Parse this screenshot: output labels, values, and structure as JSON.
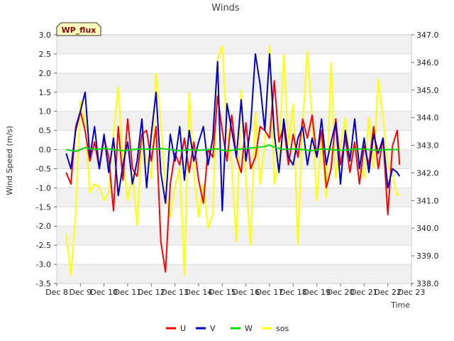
{
  "chart_data": {
    "type": "line",
    "title": "Winds",
    "xlabel": "Time",
    "ylabel": "Wind Speed (m/s)",
    "badge": "WP_flux",
    "x_range": [
      8,
      23
    ],
    "x_ticks": [
      "Dec 8",
      "Dec 9",
      "Dec 10",
      "Dec 11",
      "Dec 12",
      "Dec 13",
      "Dec 14",
      "Dec 15",
      "Dec 16",
      "Dec 17",
      "Dec 18",
      "Dec 19",
      "Dec 20",
      "Dec 21",
      "Dec 22",
      "Dec 23"
    ],
    "ylim": [
      -3.5,
      3.0
    ],
    "y_ticks": [
      "-3.5",
      "-3.0",
      "-2.5",
      "-2.0",
      "-1.5",
      "-1.0",
      "-0.5",
      "0.0",
      "0.5",
      "1.0",
      "1.5",
      "2.0",
      "2.5",
      "3.0"
    ],
    "y2lim": [
      338.0,
      347.0
    ],
    "y2_ticks": [
      "338.0",
      "339.0",
      "340.0",
      "341.0",
      "342.0",
      "343.0",
      "344.0",
      "345.0",
      "346.0",
      "347.0"
    ],
    "grid": "horizontal bands",
    "legend_position": "bottom",
    "series": [
      {
        "name": "U",
        "color": "#ff0000",
        "axis": "left",
        "x": [
          8.4,
          8.6,
          8.8,
          9.0,
          9.2,
          9.4,
          9.6,
          9.8,
          10.0,
          10.2,
          10.4,
          10.6,
          10.8,
          11.0,
          11.2,
          11.4,
          11.6,
          11.8,
          12.0,
          12.2,
          12.4,
          12.6,
          12.8,
          13.0,
          13.2,
          13.4,
          13.6,
          13.8,
          14.0,
          14.2,
          14.4,
          14.6,
          14.8,
          15.0,
          15.2,
          15.4,
          15.6,
          15.8,
          16.0,
          16.2,
          16.4,
          16.6,
          16.8,
          17.0,
          17.2,
          17.4,
          17.6,
          17.8,
          18.0,
          18.2,
          18.4,
          18.6,
          18.8,
          19.0,
          19.2,
          19.4,
          19.6,
          19.8,
          20.0,
          20.2,
          20.4,
          20.6,
          20.8,
          21.0,
          21.2,
          21.4,
          21.6,
          21.8,
          22.0,
          22.2,
          22.4,
          22.5
        ],
        "y": [
          -0.6,
          -0.9,
          0.6,
          1.0,
          0.5,
          -0.3,
          0.2,
          -0.5,
          0.3,
          -0.2,
          -1.6,
          0.6,
          -0.8,
          0.8,
          -0.5,
          -0.7,
          0.4,
          0.5,
          -0.3,
          0.6,
          -2.4,
          -3.2,
          -0.9,
          -0.1,
          -0.4,
          0.3,
          -0.6,
          0.2,
          -0.8,
          -1.4,
          0.0,
          -0.2,
          1.4,
          0.5,
          -0.3,
          0.9,
          -0.2,
          -0.6,
          0.7,
          -0.5,
          -0.2,
          0.6,
          0.5,
          0.3,
          1.8,
          0.2,
          0.6,
          -0.4,
          0.4,
          -0.2,
          0.8,
          0.3,
          0.9,
          -0.2,
          0.5,
          -1.0,
          -0.5,
          0.8,
          -0.4,
          0.3,
          -0.6,
          0.2,
          -0.9,
          0.1,
          -0.4,
          0.6,
          -0.5,
          0.3,
          -1.7,
          0.1,
          0.5,
          -0.4
        ]
      },
      {
        "name": "V",
        "color": "#0000cc",
        "axis": "left",
        "x": [
          8.4,
          8.6,
          8.8,
          9.0,
          9.2,
          9.4,
          9.6,
          9.8,
          10.0,
          10.2,
          10.4,
          10.6,
          10.8,
          11.0,
          11.2,
          11.4,
          11.6,
          11.8,
          12.0,
          12.2,
          12.4,
          12.6,
          12.8,
          13.0,
          13.2,
          13.4,
          13.6,
          13.8,
          14.0,
          14.2,
          14.4,
          14.6,
          14.8,
          15.0,
          15.2,
          15.4,
          15.6,
          15.8,
          16.0,
          16.2,
          16.4,
          16.6,
          16.8,
          17.0,
          17.2,
          17.4,
          17.6,
          17.8,
          18.0,
          18.2,
          18.4,
          18.6,
          18.8,
          19.0,
          19.2,
          19.4,
          19.6,
          19.8,
          20.0,
          20.2,
          20.4,
          20.6,
          20.8,
          21.0,
          21.2,
          21.4,
          21.6,
          21.8,
          22.0,
          22.2,
          22.4,
          22.5
        ],
        "y": [
          -0.1,
          -0.5,
          0.5,
          1.0,
          1.5,
          -0.2,
          0.6,
          -0.5,
          0.4,
          -0.6,
          0.3,
          -1.2,
          -0.4,
          0.2,
          -0.9,
          -0.3,
          0.8,
          -1.0,
          0.4,
          1.5,
          -0.6,
          -1.4,
          0.4,
          -0.3,
          0.6,
          -0.8,
          0.5,
          -0.3,
          0.2,
          0.6,
          -0.4,
          0.3,
          2.3,
          -1.6,
          1.2,
          0.5,
          -0.2,
          1.3,
          -0.3,
          0.6,
          2.5,
          1.7,
          0.5,
          2.5,
          0.4,
          -0.6,
          0.8,
          -0.2,
          -0.4,
          0.3,
          0.6,
          -0.4,
          0.3,
          -0.2,
          0.8,
          -0.4,
          0.2,
          0.7,
          -0.9,
          0.5,
          -0.3,
          0.8,
          -0.5,
          0.3,
          -0.6,
          0.4,
          -0.1,
          0.3,
          -1.0,
          -0.5,
          -0.6,
          -0.7
        ]
      },
      {
        "name": "W",
        "color": "#00dd00",
        "axis": "left",
        "x": [
          8.4,
          8.8,
          9.2,
          9.6,
          10.0,
          10.4,
          10.8,
          11.2,
          11.6,
          12.0,
          12.4,
          12.8,
          13.2,
          13.6,
          14.0,
          14.4,
          14.8,
          15.2,
          15.6,
          16.0,
          16.4,
          16.8,
          17.0,
          17.2,
          17.6,
          18.0,
          18.4,
          18.8,
          19.2,
          19.6,
          20.0,
          20.4,
          20.8,
          21.2,
          21.6,
          22.0,
          22.5
        ],
        "y": [
          0.0,
          -0.05,
          0.05,
          0.0,
          0.03,
          0.0,
          -0.03,
          0.0,
          0.02,
          0.0,
          0.03,
          0.0,
          -0.03,
          0.0,
          -0.02,
          0.0,
          0.02,
          -0.04,
          0.0,
          0.03,
          0.05,
          0.08,
          0.12,
          0.06,
          0.0,
          0.02,
          0.0,
          -0.03,
          0.02,
          0.0,
          -0.02,
          0.0,
          0.02,
          0.0,
          -0.02,
          0.0,
          0.0
        ]
      },
      {
        "name": "sos",
        "color": "#ffff00",
        "axis": "right",
        "x": [
          8.4,
          8.6,
          8.8,
          9.0,
          9.2,
          9.4,
          9.6,
          9.8,
          10.0,
          10.2,
          10.4,
          10.6,
          10.8,
          11.0,
          11.2,
          11.4,
          11.6,
          11.8,
          12.0,
          12.2,
          12.4,
          12.6,
          12.8,
          13.0,
          13.2,
          13.4,
          13.6,
          13.8,
          14.0,
          14.2,
          14.4,
          14.6,
          14.8,
          15.0,
          15.2,
          15.4,
          15.6,
          15.8,
          16.0,
          16.2,
          16.4,
          16.6,
          16.8,
          17.0,
          17.2,
          17.4,
          17.6,
          17.8,
          18.0,
          18.2,
          18.4,
          18.6,
          18.8,
          19.0,
          19.2,
          19.4,
          19.6,
          19.8,
          20.0,
          20.2,
          20.4,
          20.6,
          20.8,
          21.0,
          21.2,
          21.4,
          21.6,
          21.8,
          22.0,
          22.2,
          22.4,
          22.5
        ],
        "y": [
          339.8,
          338.3,
          340.5,
          344.6,
          343.8,
          341.3,
          341.6,
          341.5,
          341.0,
          341.3,
          343.4,
          345.1,
          342.5,
          341.0,
          342.0,
          340.1,
          343.3,
          342.5,
          341.8,
          345.6,
          343.8,
          341.3,
          340.4,
          341.5,
          342.2,
          338.3,
          344.9,
          342.0,
          340.4,
          341.6,
          340.0,
          340.5,
          346.1,
          346.6,
          343.5,
          342.3,
          339.5,
          345.0,
          341.7,
          339.4,
          344.2,
          341.6,
          343.0,
          346.6,
          341.6,
          342.5,
          346.3,
          343.0,
          344.5,
          339.4,
          343.8,
          346.4,
          344.0,
          341.0,
          343.3,
          341.1,
          346.0,
          341.8,
          343.0,
          344.0,
          342.5,
          343.1,
          342.5,
          341.8,
          344.0,
          342.2,
          345.4,
          344.0,
          342.3,
          341.9,
          341.2,
          341.2
        ]
      }
    ]
  }
}
